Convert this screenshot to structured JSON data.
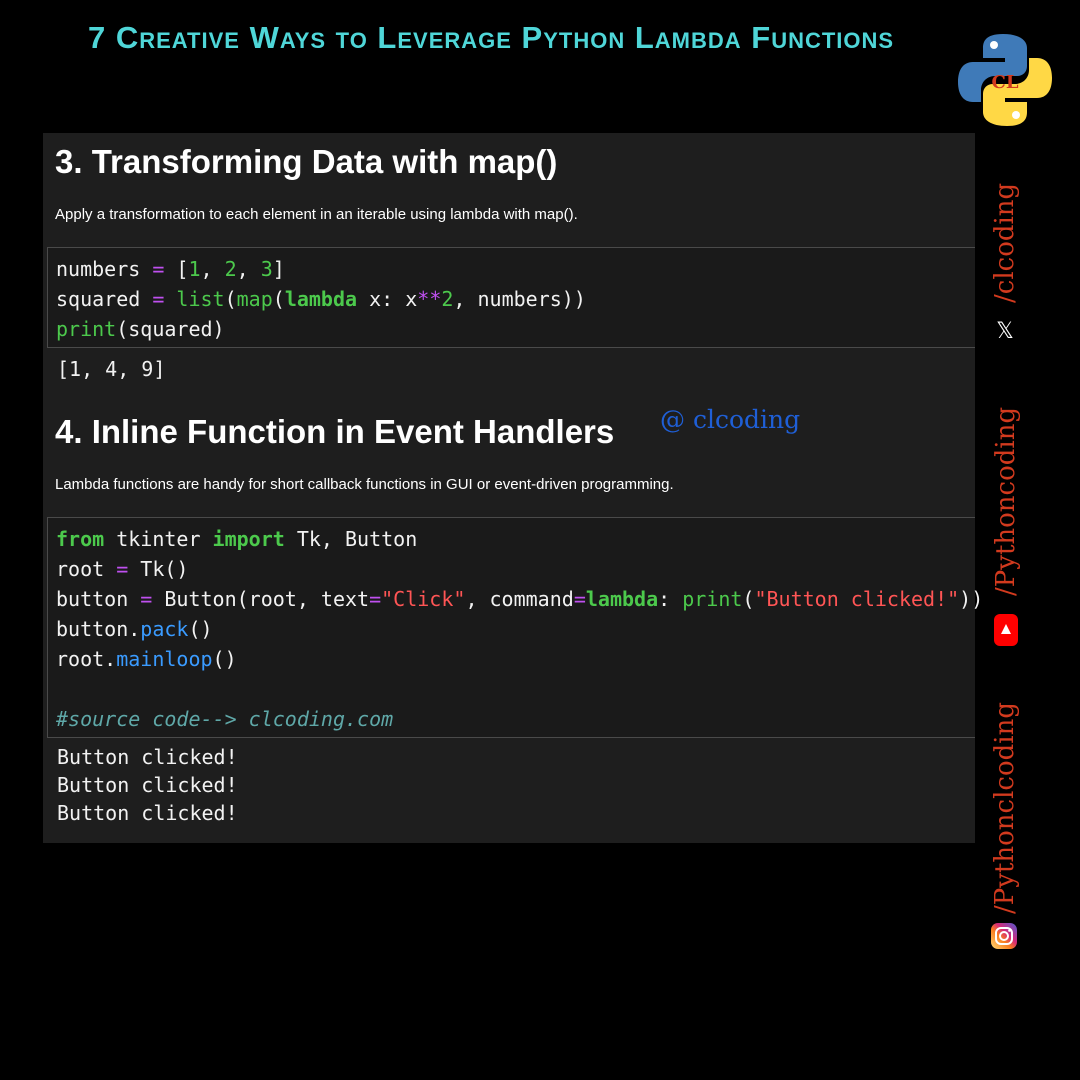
{
  "header": {
    "title": "7 Creative Ways to Leverage Python Lambda Functions",
    "logo_text": "CL"
  },
  "section3": {
    "heading": "3. Transforming Data with map()",
    "description": "Apply a transformation to each element in an iterable using lambda with map().",
    "code": {
      "l1": {
        "a": "numbers ",
        "b": "=",
        "c": " [",
        "d": "1",
        "e": ", ",
        "f": "2",
        "g": ", ",
        "h": "3",
        "i": "]"
      },
      "l2": {
        "a": "squared ",
        "b": "=",
        "c": " ",
        "d": "list",
        "e": "(",
        "f": "map",
        "g": "(",
        "h": "lambda",
        "i": " x: x",
        "j": "**",
        "k": "2",
        "l": ", numbers))"
      },
      "l3": {
        "a": "print",
        "b": "(squared)"
      }
    },
    "output": "[1, 4, 9]"
  },
  "section4": {
    "heading": "4. Inline Function in Event Handlers",
    "description": "Lambda functions are handy for short callback functions in GUI or event-driven programming.",
    "code": {
      "l1": {
        "a": "from",
        "b": " tkinter ",
        "c": "import",
        "d": " Tk, Button"
      },
      "l2": {
        "a": "root ",
        "b": "=",
        "c": " Tk()"
      },
      "l3": {
        "a": "button ",
        "b": "=",
        "c": " Button(root, text",
        "d": "=",
        "e": "\"Click\"",
        "f": ", command",
        "g": "=",
        "h": "lambda",
        "i": ": ",
        "j": "print",
        "k": "(",
        "l": "\"Button clicked!\"",
        "m": "))"
      },
      "l4": {
        "a": "button.",
        "b": "pack",
        "c": "()"
      },
      "l5": {
        "a": "root.",
        "b": "mainloop",
        "c": "()"
      },
      "comment": "#source code--> clcoding.com"
    },
    "output": [
      "Button clicked!",
      "Button clicked!",
      "Button clicked!"
    ]
  },
  "watermark": "@ clcoding",
  "social": {
    "x_handle": "/clcoding",
    "youtube_handle": "/Pythoncoding",
    "instagram_handle": "/Pythonclcoding"
  },
  "colors": {
    "title": "#4fd6d8",
    "handle": "#d23a1e",
    "keyword": "#4cc94c",
    "string": "#ff5555",
    "operator": "#c050f0",
    "method": "#3a9bff"
  }
}
